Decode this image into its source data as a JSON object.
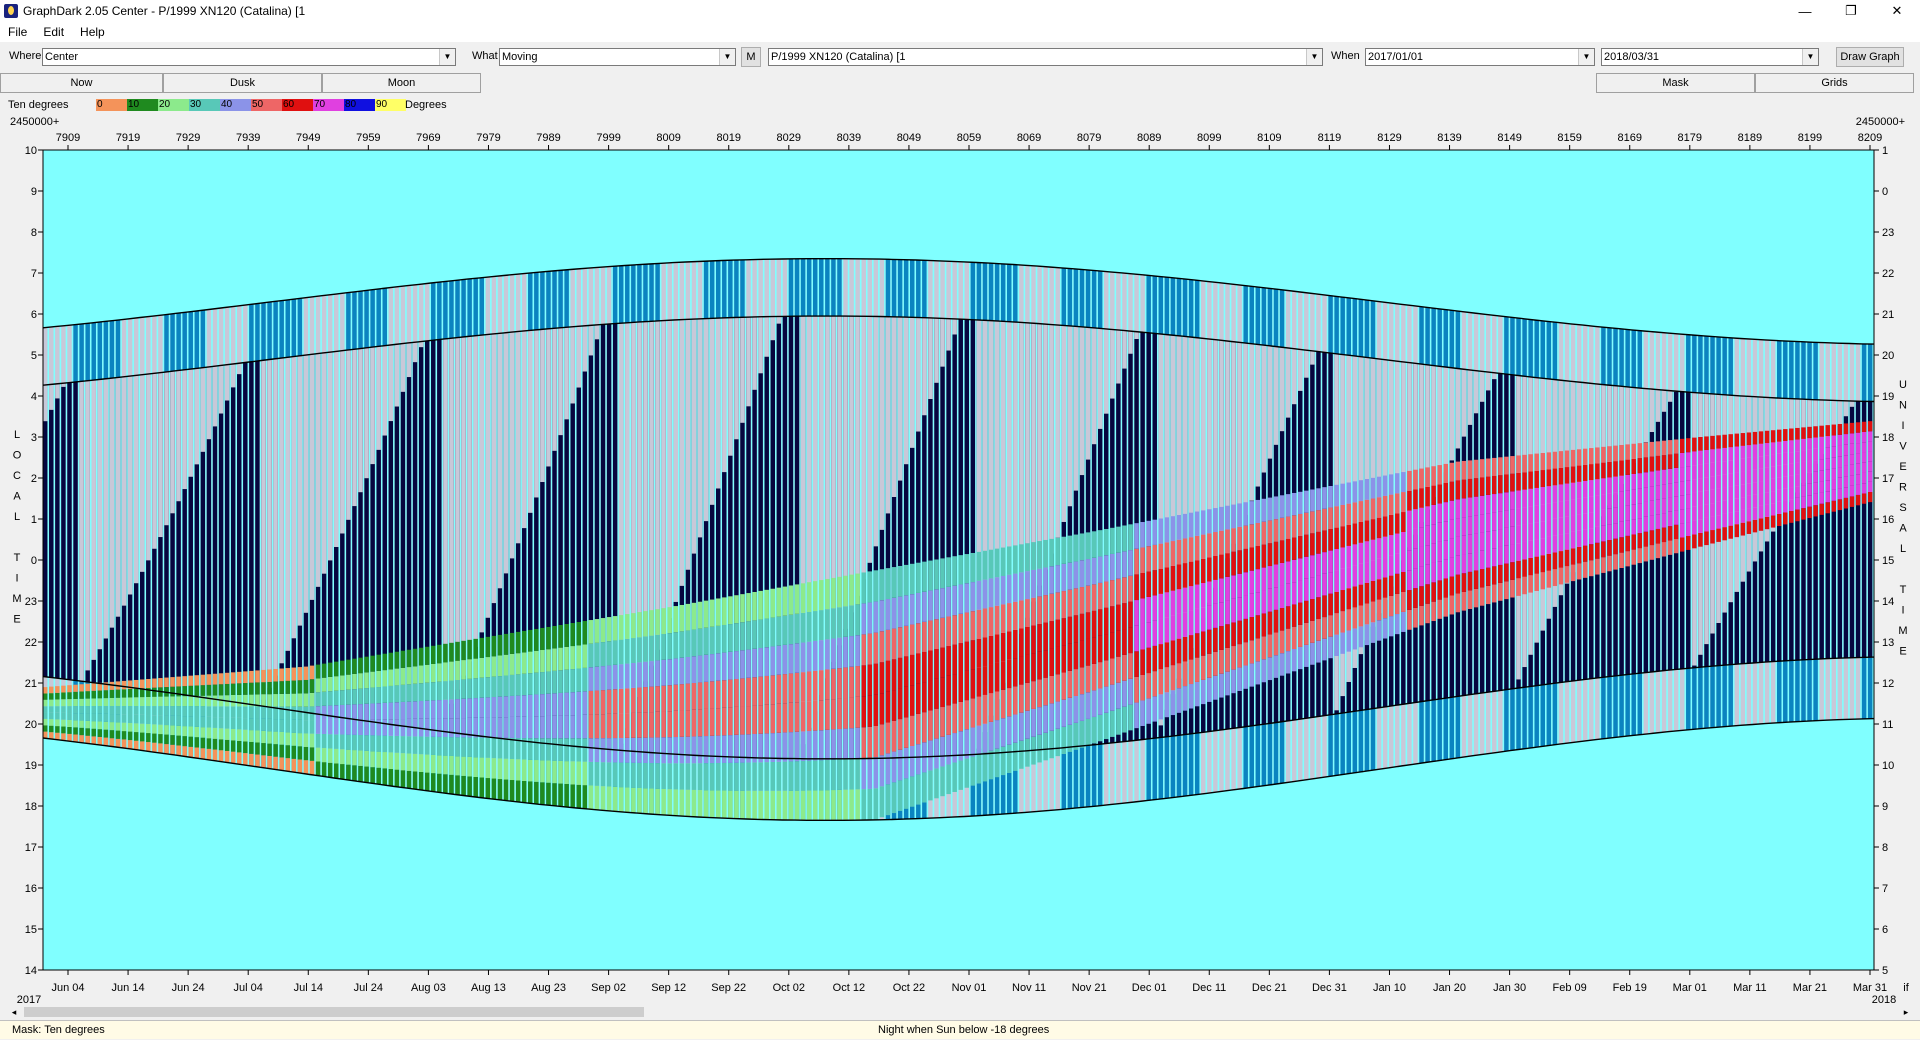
{
  "window": {
    "title": "GraphDark 2.05  Center  -  P/1999 XN120 (Catalina) [1",
    "minimize": "—",
    "restore": "❐",
    "close": "✕"
  },
  "menu": {
    "file": "File",
    "edit": "Edit",
    "help": "Help"
  },
  "toolbar": {
    "where_label": "Where",
    "where_value": "Center",
    "what_label": "What",
    "what_value": "Moving",
    "m_button": "M",
    "object_value": "P/1999 XN120 (Catalina) [1",
    "when_label": "When",
    "start_date": "2017/01/01",
    "end_date": "2018/03/31",
    "draw_button": "Draw Graph"
  },
  "tabs": {
    "now": "Now",
    "dusk": "Dusk",
    "moon": "Moon",
    "mask": "Mask",
    "grids": "Grids"
  },
  "legend": {
    "label": "Ten degrees",
    "unit": "Degrees",
    "swatches": [
      {
        "label": "0",
        "color": "#f4935a"
      },
      {
        "label": "10",
        "color": "#1f8a1f"
      },
      {
        "label": "20",
        "color": "#8cea8c"
      },
      {
        "label": "30",
        "color": "#58c8b8"
      },
      {
        "label": "40",
        "color": "#8b93e8"
      },
      {
        "label": "50",
        "color": "#ee6666"
      },
      {
        "label": "60",
        "color": "#e01010"
      },
      {
        "label": "70",
        "color": "#e040e0"
      },
      {
        "label": "80",
        "color": "#1010e0"
      },
      {
        "label": "90",
        "color": "#ffff66"
      }
    ]
  },
  "chart_data": {
    "type": "heatmap",
    "top_axis_prefix_left": "2450000+",
    "top_axis_prefix_right": "2450000+",
    "jd_ticks": [
      "7909",
      "7919",
      "7929",
      "7939",
      "7949",
      "7959",
      "7969",
      "7979",
      "7989",
      "7999",
      "8009",
      "8019",
      "8029",
      "8039",
      "8049",
      "8059",
      "8069",
      "8079",
      "8089",
      "8099",
      "8109",
      "8119",
      "8129",
      "8139",
      "8149",
      "8159",
      "8169",
      "8179",
      "8189",
      "8199",
      "8209"
    ],
    "date_ticks": [
      "Jun 04",
      "Jun 14",
      "Jun 24",
      "Jul 04",
      "Jul 14",
      "Jul 24",
      "Aug 03",
      "Aug 13",
      "Aug 23",
      "Sep 02",
      "Sep 12",
      "Sep 22",
      "Oct 02",
      "Oct 12",
      "Oct 22",
      "Nov 01",
      "Nov 11",
      "Nov 21",
      "Dec 01",
      "Dec 11",
      "Dec 21",
      "Dec 31",
      "Jan 10",
      "Jan 20",
      "Jan 30",
      "Feb 09",
      "Feb 19",
      "Mar 01",
      "Mar 11",
      "Mar 21",
      "Mar 31"
    ],
    "year_left": "2017",
    "year_right": "2018",
    "corner_right": "if",
    "left_ticks": [
      "10",
      "9",
      "8",
      "7",
      "6",
      "5",
      "4",
      "3",
      "2",
      "1",
      "0",
      "23",
      "22",
      "21",
      "20",
      "19",
      "18",
      "17",
      "16",
      "15",
      "14"
    ],
    "right_ticks": [
      "1",
      "0",
      "23",
      "22",
      "21",
      "20",
      "19",
      "18",
      "17",
      "16",
      "15",
      "14",
      "13",
      "12",
      "11",
      "10",
      "9",
      "8",
      "7",
      "6",
      "5"
    ],
    "left_axis_label": [
      "L",
      "O",
      "C",
      "A",
      "L",
      "",
      "T",
      "I",
      "M",
      "E"
    ],
    "right_axis_label": [
      "U",
      "N",
      "I",
      "V",
      "E",
      "R",
      "S",
      "A",
      "L",
      "",
      "T",
      "I",
      "M",
      "E"
    ],
    "x_range_jd": [
      7907,
      8209
    ],
    "y_range_hours": [
      14,
      34
    ],
    "colors": {
      "background": "#80ffff",
      "night": "#06063f",
      "moon_up_stripe": "#c8c8d8",
      "twilight_blue": "#0a84c0"
    }
  },
  "status": {
    "mask": "Mask:  Ten degrees",
    "night": "Night when Sun below -18 degrees"
  },
  "scroll": {
    "left": "◂",
    "right": "▸"
  }
}
